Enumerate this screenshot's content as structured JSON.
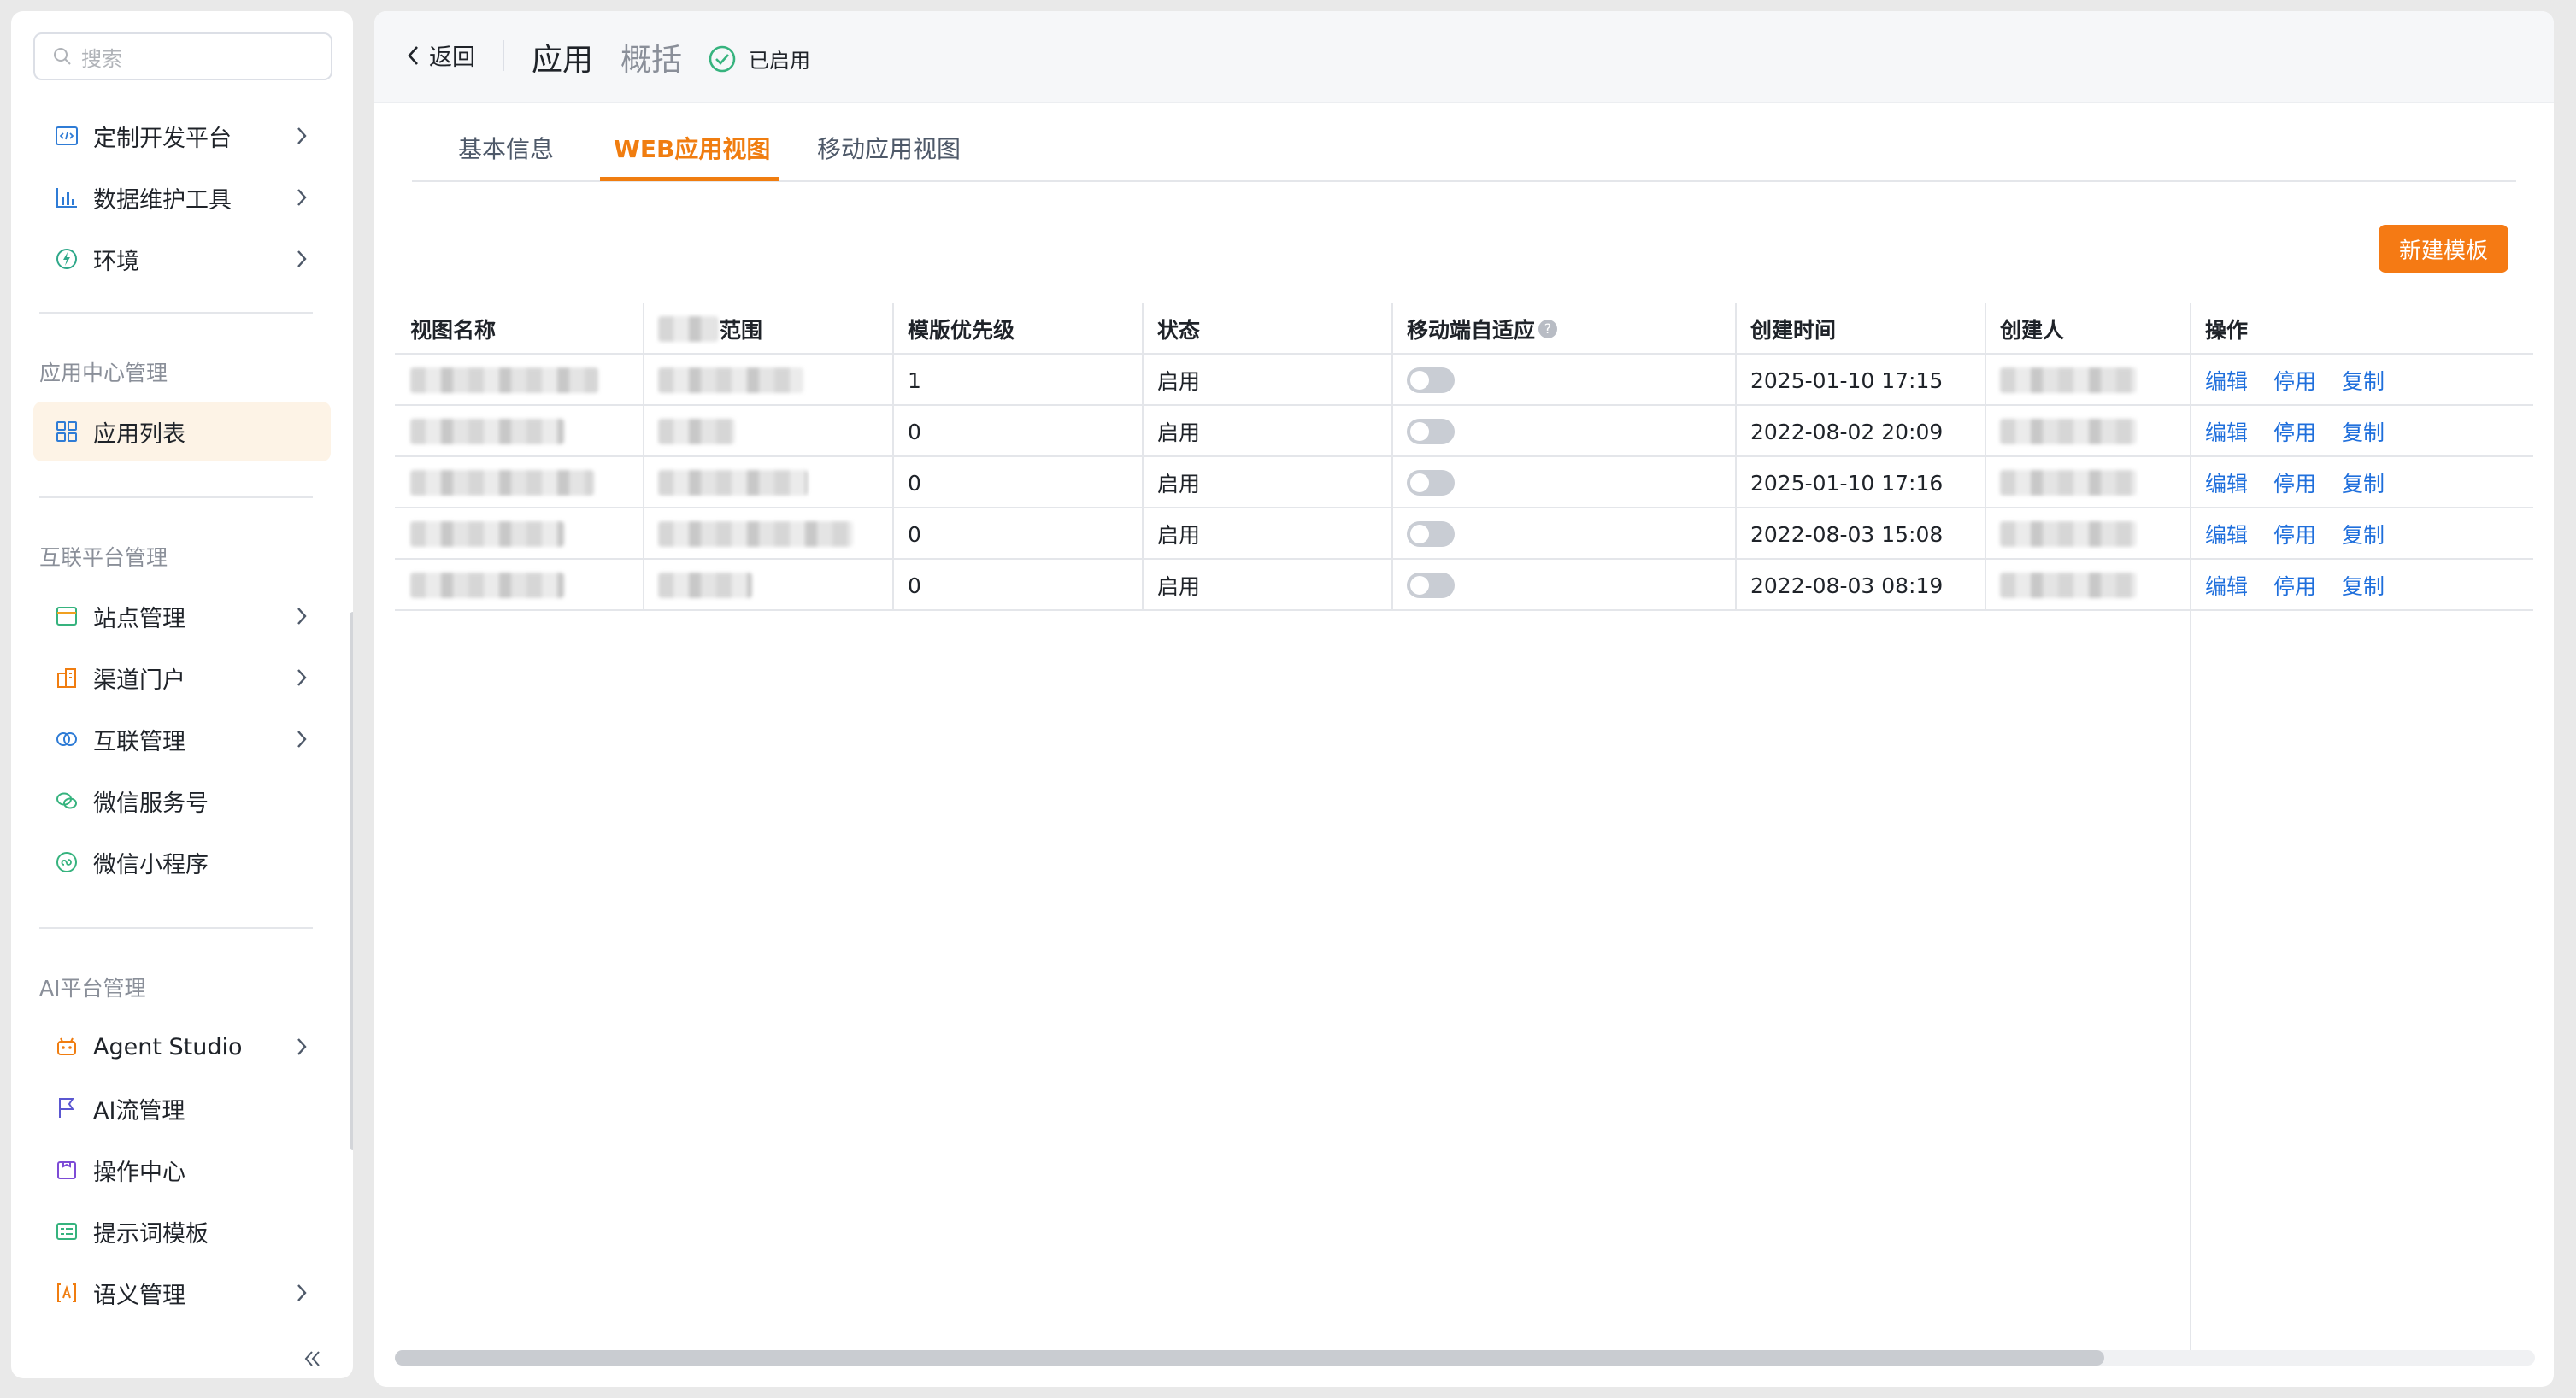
{
  "sidebar": {
    "search_placeholder": "搜索",
    "top_items": [
      {
        "label": "定制开发平台",
        "icon": "code-icon"
      },
      {
        "label": "数据维护工具",
        "icon": "bar-chart-icon"
      },
      {
        "label": "环境",
        "icon": "environment-icon"
      }
    ],
    "section_app": "应用中心管理",
    "app_items": [
      {
        "label": "应用列表",
        "icon": "grid-icon",
        "active": true
      }
    ],
    "section_internet": "互联平台管理",
    "internet_items": [
      {
        "label": "站点管理",
        "icon": "site-icon"
      },
      {
        "label": "渠道门户",
        "icon": "building-icon"
      },
      {
        "label": "互联管理",
        "icon": "link-rings-icon"
      },
      {
        "label": "微信服务号",
        "icon": "wechat-icon"
      },
      {
        "label": "微信小程序",
        "icon": "mini-program-icon"
      }
    ],
    "section_ai": "AI平台管理",
    "ai_items": [
      {
        "label": "Agent Studio",
        "icon": "robot-icon"
      },
      {
        "label": "AI流管理",
        "icon": "flag-icon"
      },
      {
        "label": "操作中心",
        "icon": "operation-icon"
      },
      {
        "label": "提示词模板",
        "icon": "template-icon"
      },
      {
        "label": "语义管理",
        "icon": "semantic-icon"
      }
    ]
  },
  "header": {
    "back_label": "返回",
    "title": "应用",
    "subtitle": "概括",
    "status_label": "已启用"
  },
  "tabs": [
    {
      "label": "基本信息"
    },
    {
      "label": "WEB应用视图",
      "active": true
    },
    {
      "label": "移动应用视图"
    }
  ],
  "toolbar": {
    "new_template_label": "新建模板"
  },
  "table": {
    "columns": [
      "视图名称",
      "范围",
      "模版优先级",
      "状态",
      "移动端自适应",
      "创建时间",
      "创建人",
      "操作"
    ],
    "help_glyph": "?",
    "actions": {
      "edit": "编辑",
      "disable": "停用",
      "copy": "复制"
    },
    "rows": [
      {
        "priority": "1",
        "status": "启用",
        "created": "2025-01-10 17:15"
      },
      {
        "priority": "0",
        "status": "启用",
        "created": "2022-08-02 20:09"
      },
      {
        "priority": "0",
        "status": "启用",
        "created": "2025-01-10 17:16"
      },
      {
        "priority": "0",
        "status": "启用",
        "created": "2022-08-03 15:08"
      },
      {
        "priority": "0",
        "status": "启用",
        "created": "2022-08-03 08:19"
      }
    ]
  },
  "colors": {
    "accent": "#f07d10",
    "link": "#1f6fdc",
    "button": "#f57a14"
  }
}
